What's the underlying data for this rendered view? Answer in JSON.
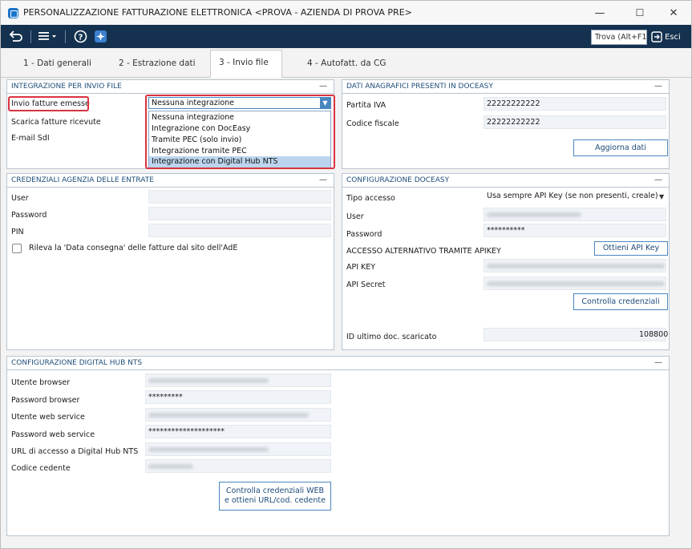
{
  "window": {
    "title": "PERSONALIZZAZIONE FATTURAZIONE ELETTRONICA <PROVA - AZIENDA DI PROVA PRE>",
    "controls": {
      "minimize": "—",
      "maximize": "☐",
      "close": "✕"
    }
  },
  "toolbar": {
    "search_label": "Trova (Alt+F1)",
    "exit_label": "Esci"
  },
  "tabs": [
    {
      "label": "1 - Dati generali"
    },
    {
      "label": "2 - Estrazione dati"
    },
    {
      "label": "3 - Invio file",
      "active": true
    },
    {
      "label": "4 - Autofatt. da CG"
    }
  ],
  "integration": {
    "title": "INTEGRAZIONE PER INVIO FILE",
    "invio_label": "Invio fatture emesse",
    "scarica_label": "Scarica fatture ricevute",
    "email_label": "E-mail SdI",
    "selected_value": "Nessuna integrazione",
    "options": [
      "Nessuna integrazione",
      "Integrazione con DocEasy",
      "Tramite PEC (solo invio)",
      "Integrazione tramite PEC",
      "Integrazione con Digital Hub NTS"
    ],
    "highlighted_option": "Integrazione con Digital Hub NTS"
  },
  "anagrafica": {
    "title": "DATI ANAGRAFICI PRESENTI IN DOCEASY",
    "partita_iva_label": "Partita IVA",
    "partita_iva": "22222222222",
    "codice_fiscale_label": "Codice fiscale",
    "codice_fiscale": "22222222222",
    "update_button": "Aggiorna dati"
  },
  "credenziali_ade": {
    "title": "CREDENZIALI AGENZIA DELLE ENTRATE",
    "user_label": "User",
    "password_label": "Password",
    "pin_label": "PIN",
    "checkbox_label": "Rileva la 'Data consegna' delle fatture dal sito dell'AdE"
  },
  "doceasy": {
    "title": "CONFIGURAZIONE DOCEASY",
    "tipo_accesso_label": "Tipo accesso",
    "tipo_accesso_value": "Usa sempre API Key (se non presenti, creale)",
    "user_label": "User",
    "password_label": "Password",
    "password_value": "**********",
    "apikey_section_label": "ACCESSO ALTERNATIVO TRAMITE APIKEY",
    "get_apikey_button": "Ottieni API Key",
    "apikey_label": "API KEY",
    "apisecret_label": "API Secret",
    "check_credentials_button": "Controlla credenziali",
    "last_doc_label": "ID ultimo doc. scaricato",
    "last_doc_value": "108800"
  },
  "digital_hub": {
    "title": "CONFIGURAZIONE DIGITAL HUB NTS",
    "utente_browser_label": "Utente browser",
    "password_browser_label": "Password browser",
    "password_browser_value": "*********",
    "utente_ws_label": "Utente web service",
    "password_ws_label": "Password web service",
    "password_ws_value": "********************",
    "url_label": "URL di accesso a Digital Hub NTS",
    "codice_cedente_label": "Codice cedente",
    "check_button": "Controlla credenziali WEB e ottieni URL/cod. cedente"
  },
  "colors": {
    "toolbar_bg": "#14314f",
    "accent": "#4a86c0",
    "highlight_red": "#d9333f",
    "dropdown_selected": "#bcd5ee"
  }
}
